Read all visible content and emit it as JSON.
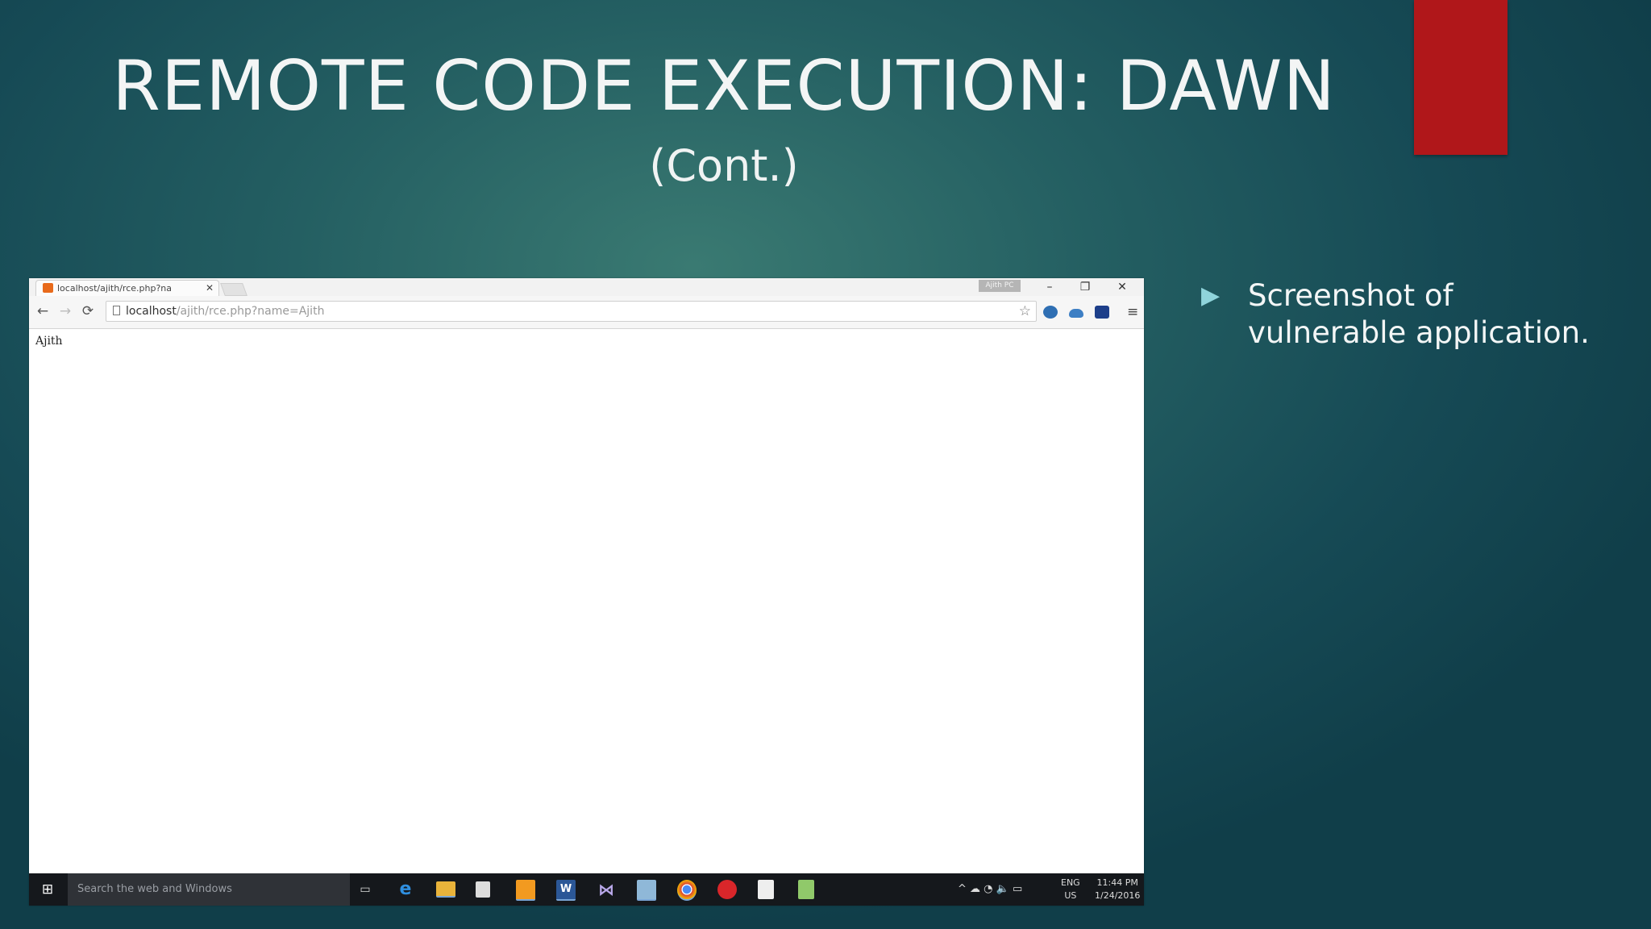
{
  "slide": {
    "title": "REMOTE CODE EXECUTION: DAWN",
    "subtitle": "(Cont.)",
    "bullet_marker": "▶",
    "bullet": "Screenshot of vulnerable application.",
    "accent_color": "#b0171a"
  },
  "browser": {
    "tab_title": "localhost/ajith/rce.php?na",
    "tab_close": "✕",
    "user_chip": "Ajith PC",
    "window_controls": {
      "minimize": "–",
      "restore": "❐",
      "close": "✕"
    },
    "nav": {
      "back": "←",
      "forward": "→",
      "reload": "⟳"
    },
    "url_host": "localhost",
    "url_path": "/ajith/rce.php?name=Ajith",
    "bookmark_star": "☆",
    "menu": "≡",
    "page_text": "Ajith"
  },
  "taskbar": {
    "start_icon": "windows-icon",
    "search_placeholder": "Search the web and Windows",
    "apps": [
      "task-view",
      "edge",
      "file-explorer",
      "store",
      "sublime",
      "word",
      "visual-studio",
      "notepad",
      "chrome",
      "red-app",
      "edit-doc",
      "notepad-plus"
    ],
    "tray_symbols": "^ ☁ ◔ 🔈 ▭",
    "language": "ENG",
    "region": "US",
    "time": "11:44 PM",
    "date": "1/24/2016"
  }
}
